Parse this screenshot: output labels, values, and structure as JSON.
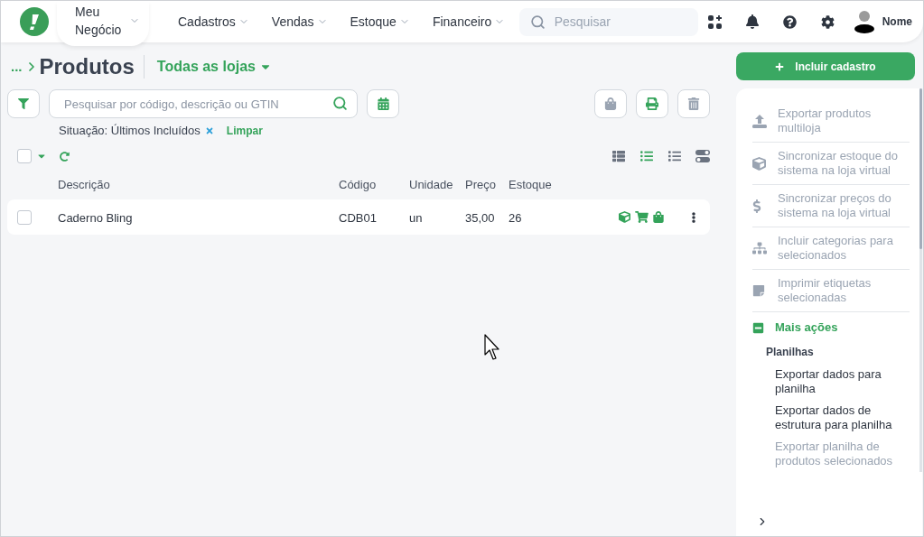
{
  "top_nav": {
    "menu": [
      {
        "label": "Meu Negócio",
        "selected": true
      },
      {
        "label": "Cadastros",
        "selected": false
      },
      {
        "label": "Vendas",
        "selected": false
      },
      {
        "label": "Estoque",
        "selected": false
      },
      {
        "label": "Financeiro",
        "selected": false
      }
    ],
    "search": {
      "placeholder": "Pesquisar"
    },
    "user": {
      "name": "Nome"
    }
  },
  "page_header": {
    "breadcrumb": "...",
    "title": "Produtos",
    "store_selector": "Todas as lojas"
  },
  "toolbar": {
    "search": {
      "placeholder": "Pesquisar por código, descrição ou GTIN"
    },
    "actions": [
      {
        "kind": "bag",
        "disabled": true
      },
      {
        "kind": "print",
        "disabled": false
      },
      {
        "kind": "trash",
        "disabled": true
      }
    ]
  },
  "filter": {
    "label": "Situação: Últimos Incluídos",
    "clear": "Limpar"
  },
  "list_controls": {
    "select_all": {
      "checked": false
    },
    "views": [
      {
        "kind": "table",
        "selected": false
      },
      {
        "kind": "detail",
        "selected": true
      },
      {
        "kind": "list",
        "selected": false
      },
      {
        "kind": "toggle",
        "selected": false
      }
    ]
  },
  "table": {
    "columns": [
      "Descrição",
      "Código",
      "Unidade",
      "Preço",
      "Estoque"
    ],
    "rows": [
      {
        "checked": false,
        "cells": [
          "Caderno Bling",
          "CDB01",
          "un",
          "35,00",
          "26"
        ]
      }
    ]
  },
  "sidebar": {
    "primary_button": "Incluir cadastro",
    "actions": [
      {
        "label": "Exportar produtos multiloja",
        "disabled": true
      },
      {
        "label": "Sincronizar estoque do sistema na loja virtual",
        "disabled": true
      },
      {
        "label": "Sincronizar preços do sistema na loja virtual",
        "disabled": true
      },
      {
        "label": "Incluir categorias para selecionados",
        "disabled": true
      },
      {
        "label": "Imprimir etiquetas selecionadas",
        "disabled": true
      }
    ],
    "more_actions": {
      "label": "Mais ações",
      "expanded": true,
      "groups": [
        {
          "title": "Planilhas",
          "items": [
            {
              "label": "Exportar dados para planilha",
              "disabled": false
            },
            {
              "label": "Exportar dados de estrutura para planilha",
              "disabled": false
            },
            {
              "label": "Exportar planilha de produtos selecionados",
              "disabled": true
            }
          ]
        }
      ]
    }
  }
}
